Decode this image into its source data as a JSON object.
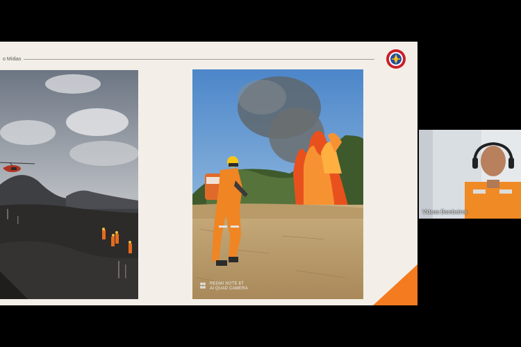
{
  "slide": {
    "title_fragment": "o Mídias"
  },
  "photos": {
    "right_watermark_line1": "REDMI NOTE 8T",
    "right_watermark_line2": "AI QUAD CAMERA"
  },
  "participant": {
    "name": "Videos Bombeiros"
  },
  "colors": {
    "accent_orange": "#f47b20",
    "slide_bg": "#f3efe8",
    "app_bg": "#000000"
  }
}
